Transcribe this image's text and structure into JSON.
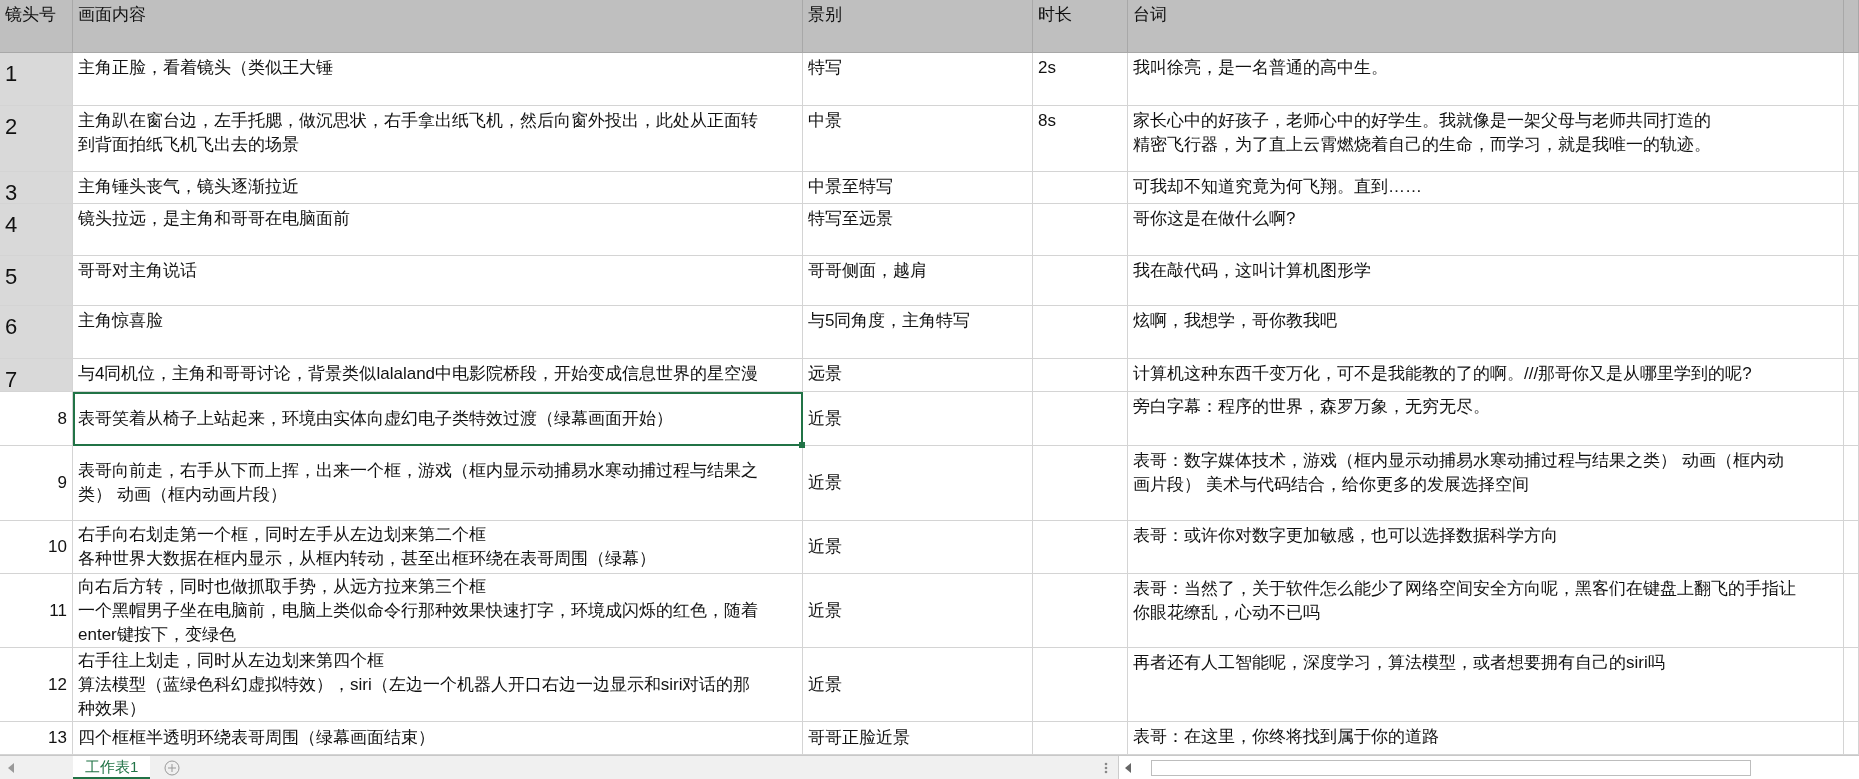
{
  "sheet": {
    "columns": [
      "镜头号",
      "画面内容",
      "景别",
      "时长",
      "台词"
    ],
    "rows": [
      {
        "kind": "shaded",
        "selected": false,
        "cells": [
          "1",
          "主角正脸，看着镜头（类似王大锤",
          "特写",
          "2s",
          "我叫徐亮，是一名普通的高中生。"
        ]
      },
      {
        "kind": "shaded",
        "selected": false,
        "cells": [
          "2",
          [
            "主角趴在窗台边，左手托腮，做沉思状，右手拿出纸飞机，然后向窗外投出，此处从正面转",
            "到背面拍纸飞机飞出去的场景"
          ],
          "中景",
          "8s",
          [
            "家长心中的好孩子，老师心中的好学生。我就像是一架父母与老师共同打造的",
            "精密飞行器，为了直上云霄燃烧着自己的生命，而学习，就是我唯一的轨迹。"
          ]
        ]
      },
      {
        "kind": "shaded",
        "selected": false,
        "cells": [
          "3",
          "主角锤头丧气，镜头逐渐拉近",
          "中景至特写",
          "",
          "可我却不知道究竟为何飞翔。直到……"
        ]
      },
      {
        "kind": "shaded",
        "selected": false,
        "cells": [
          "4",
          "镜头拉远，是主角和哥哥在电脑面前",
          "特写至远景",
          "",
          "哥你这是在做什么啊?"
        ]
      },
      {
        "kind": "shaded",
        "selected": false,
        "cells": [
          "5",
          "哥哥对主角说话",
          "哥哥侧面，越肩",
          "",
          "我在敲代码，这叫计算机图形学"
        ]
      },
      {
        "kind": "shaded",
        "selected": false,
        "cells": [
          "6",
          "主角惊喜脸",
          "与5同角度，主角特写",
          "",
          "炫啊，我想学，哥你教我吧"
        ]
      },
      {
        "kind": "shaded",
        "selected": false,
        "cells": [
          "7",
          "与4同机位，主角和哥哥讨论，背景类似lalaland中电影院桥段，开始变成信息世界的星空漫",
          "远景",
          "",
          "计算机这种东西千变万化，可不是我能教的了的啊。///那哥你又是从哪里学到的呢?"
        ]
      },
      {
        "kind": "plain",
        "selected": true,
        "cells": [
          "8",
          "表哥笑着从椅子上站起来，环境由实体向虚幻电子类特效过渡（绿幕画面开始）",
          "近景",
          "",
          "旁白字幕：程序的世界，森罗万象，无穷无尽。"
        ]
      },
      {
        "kind": "plain",
        "selected": false,
        "cells": [
          "9",
          [
            "表哥向前走，右手从下而上挥，出来一个框，游戏（框内显示动捕易水寒动捕过程与结果之",
            "类） 动画（框内动画片段）"
          ],
          "近景",
          "",
          [
            "表哥：数字媒体技术，游戏（框内显示动捕易水寒动捕过程与结果之类） 动画（框内动",
            "画片段） 美术与代码结合，给你更多的发展选择空间"
          ]
        ]
      },
      {
        "kind": "plain",
        "selected": false,
        "cells": [
          "10",
          [
            "右手向右划走第一个框，同时左手从左边划来第二个框",
            "各种世界大数据在框内显示，从框内转动，甚至出框环绕在表哥周围（绿幕）"
          ],
          "近景",
          "",
          "表哥：或许你对数字更加敏感，也可以选择数据科学方向"
        ]
      },
      {
        "kind": "plain",
        "selected": false,
        "cells": [
          "11",
          [
            "向右后方转，同时也做抓取手势，从远方拉来第三个框",
            "一个黑帽男子坐在电脑前，电脑上类似命令行那种效果快速打字，环境成闪烁的红色，随着",
            "enter键按下，变绿色"
          ],
          "近景",
          "",
          [
            "表哥：当然了，关于软件怎么能少了网络空间安全方向呢，黑客们在键盘上翻飞的手指让",
            "你眼花缭乱，心动不已吗"
          ]
        ]
      },
      {
        "kind": "plain",
        "selected": false,
        "cells": [
          "12",
          [
            "右手往上划走，同时从左边划来第四个框",
            "算法模型（蓝绿色科幻虚拟特效），siri（左边一个机器人开口右边一边显示和siri对话的那",
            "种效果）"
          ],
          "近景",
          "",
          "再者还有人工智能呢，深度学习，算法模型，或者想要拥有自己的siri吗"
        ]
      },
      {
        "kind": "plain",
        "selected": false,
        "cells": [
          "13",
          "四个框框半透明环绕表哥周围（绿幕画面结束）",
          "哥哥正脸近景",
          "",
          "表哥：在这里，你终将找到属于你的道路"
        ]
      }
    ]
  },
  "sheet_tabs": [
    {
      "label": "工作表1",
      "selected": true
    }
  ]
}
